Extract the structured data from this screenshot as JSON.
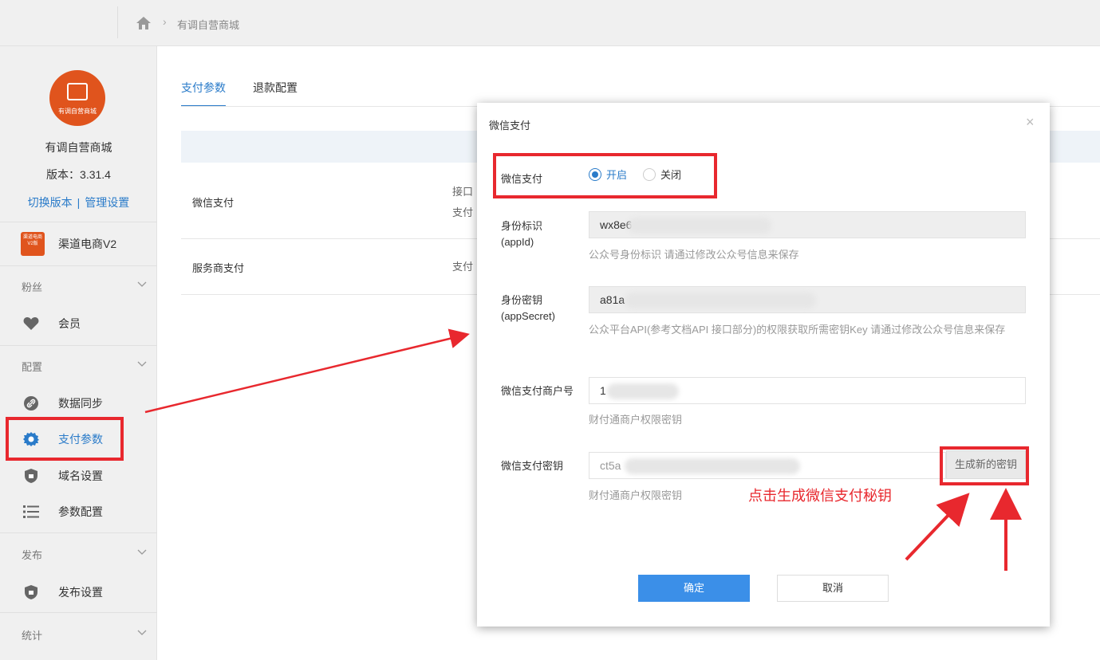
{
  "topbar": {
    "breadcrumb": "有调自营商城",
    "home_icon": "home-icon"
  },
  "sidebar": {
    "logo_caption": "有调自营商城",
    "shop_name": "有调自营商城",
    "version": "版本：3.31.4",
    "switch_version": "切换版本",
    "divider": "|",
    "manage_settings": "管理设置",
    "app": {
      "label": "渠道电商V2",
      "icon_text": "渠道电商V2版"
    },
    "groups": {
      "fans": "粉丝",
      "config": "配置",
      "publish": "发布",
      "stats": "统计"
    },
    "items": {
      "member": "会员",
      "data_sync": "数据同步",
      "payment_params": "支付参数",
      "domain_settings": "域名设置",
      "param_config": "参数配置",
      "publish_settings": "发布设置"
    }
  },
  "main": {
    "tabs": [
      "支付参数",
      "退款配置"
    ],
    "rows": [
      {
        "name": "微信支付",
        "desc1": "接口",
        "desc2": "支付"
      },
      {
        "name": "服务商支付",
        "desc1": "支付"
      }
    ]
  },
  "modal": {
    "title": "微信支付",
    "close": "×",
    "wechat_pay_label": "微信支付",
    "radio_on": "开启",
    "radio_off": "关闭",
    "appid_label_1": "身份标识",
    "appid_label_2": "(appId)",
    "appid_value": "wx8e6",
    "appid_help": "公众号身份标识 请通过修改公众号信息来保存",
    "secret_label_1": "身份密钥",
    "secret_label_2": "(appSecret)",
    "secret_value": "a81a",
    "secret_help": "公众平台API(参考文档API 接口部分)的权限获取所需密钥Key 请通过修改公众号信息来保存",
    "merchant_label": "微信支付商户号",
    "merchant_value": "1",
    "merchant_help": "财付通商户权限密钥",
    "key_label": "微信支付密钥",
    "key_value": "ct5a",
    "key_help": "财付通商户权限密钥",
    "generate_button": "生成新的密钥",
    "annotation": "点击生成微信支付秘钥",
    "ok": "确定",
    "cancel": "取消"
  },
  "colors": {
    "accent": "#2a7bc9",
    "annotation_red": "#e8282e",
    "brand_orange": "#e0541d",
    "primary_button": "#3b8fe8"
  }
}
